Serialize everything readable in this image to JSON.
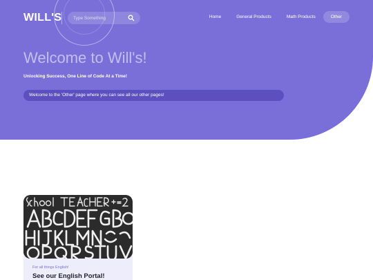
{
  "header": {
    "logo": "WILL'S",
    "search": {
      "placeholder": "Type Something",
      "icon": "search-icon"
    },
    "nav": [
      {
        "label": "Home",
        "active": false
      },
      {
        "label": "General Products",
        "active": false
      },
      {
        "label": "Math Products",
        "active": false
      },
      {
        "label": "Other",
        "active": true
      }
    ]
  },
  "hero": {
    "title": "Welcome to Will's!",
    "subtitle": "Unlocking Success, One Line of Code At a Time!",
    "banner": "Welcome to the 'Other' page where you can see all our other pages!"
  },
  "cards": [
    {
      "tag": "For all things English!",
      "title": "See our English Portal!",
      "image_text": "School TEACHER 1+1=2 ABCDEFG HIJKLMN OPQRSTU"
    }
  ],
  "colors": {
    "hero_bg": "#7a6fd8",
    "banner_bg": "#5d4fbf",
    "card_bg": "#eeedfb",
    "chalkboard": "#2e2e2e"
  }
}
